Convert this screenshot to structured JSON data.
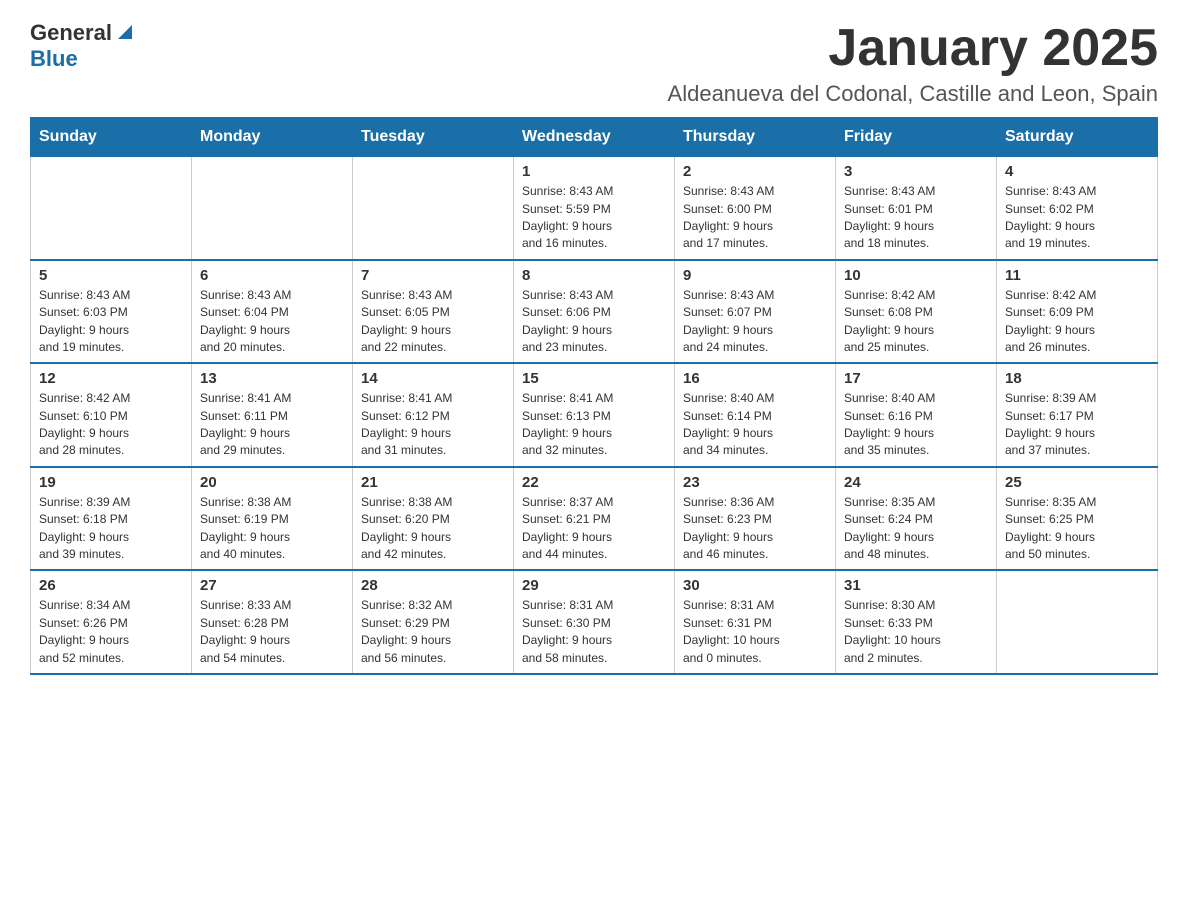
{
  "header": {
    "logo_general": "General",
    "logo_blue": "Blue",
    "title": "January 2025",
    "subtitle": "Aldeanueva del Codonal, Castille and Leon, Spain"
  },
  "days_of_week": [
    "Sunday",
    "Monday",
    "Tuesday",
    "Wednesday",
    "Thursday",
    "Friday",
    "Saturday"
  ],
  "weeks": [
    [
      {
        "day": "",
        "info": ""
      },
      {
        "day": "",
        "info": ""
      },
      {
        "day": "",
        "info": ""
      },
      {
        "day": "1",
        "info": "Sunrise: 8:43 AM\nSunset: 5:59 PM\nDaylight: 9 hours\nand 16 minutes."
      },
      {
        "day": "2",
        "info": "Sunrise: 8:43 AM\nSunset: 6:00 PM\nDaylight: 9 hours\nand 17 minutes."
      },
      {
        "day": "3",
        "info": "Sunrise: 8:43 AM\nSunset: 6:01 PM\nDaylight: 9 hours\nand 18 minutes."
      },
      {
        "day": "4",
        "info": "Sunrise: 8:43 AM\nSunset: 6:02 PM\nDaylight: 9 hours\nand 19 minutes."
      }
    ],
    [
      {
        "day": "5",
        "info": "Sunrise: 8:43 AM\nSunset: 6:03 PM\nDaylight: 9 hours\nand 19 minutes."
      },
      {
        "day": "6",
        "info": "Sunrise: 8:43 AM\nSunset: 6:04 PM\nDaylight: 9 hours\nand 20 minutes."
      },
      {
        "day": "7",
        "info": "Sunrise: 8:43 AM\nSunset: 6:05 PM\nDaylight: 9 hours\nand 22 minutes."
      },
      {
        "day": "8",
        "info": "Sunrise: 8:43 AM\nSunset: 6:06 PM\nDaylight: 9 hours\nand 23 minutes."
      },
      {
        "day": "9",
        "info": "Sunrise: 8:43 AM\nSunset: 6:07 PM\nDaylight: 9 hours\nand 24 minutes."
      },
      {
        "day": "10",
        "info": "Sunrise: 8:42 AM\nSunset: 6:08 PM\nDaylight: 9 hours\nand 25 minutes."
      },
      {
        "day": "11",
        "info": "Sunrise: 8:42 AM\nSunset: 6:09 PM\nDaylight: 9 hours\nand 26 minutes."
      }
    ],
    [
      {
        "day": "12",
        "info": "Sunrise: 8:42 AM\nSunset: 6:10 PM\nDaylight: 9 hours\nand 28 minutes."
      },
      {
        "day": "13",
        "info": "Sunrise: 8:41 AM\nSunset: 6:11 PM\nDaylight: 9 hours\nand 29 minutes."
      },
      {
        "day": "14",
        "info": "Sunrise: 8:41 AM\nSunset: 6:12 PM\nDaylight: 9 hours\nand 31 minutes."
      },
      {
        "day": "15",
        "info": "Sunrise: 8:41 AM\nSunset: 6:13 PM\nDaylight: 9 hours\nand 32 minutes."
      },
      {
        "day": "16",
        "info": "Sunrise: 8:40 AM\nSunset: 6:14 PM\nDaylight: 9 hours\nand 34 minutes."
      },
      {
        "day": "17",
        "info": "Sunrise: 8:40 AM\nSunset: 6:16 PM\nDaylight: 9 hours\nand 35 minutes."
      },
      {
        "day": "18",
        "info": "Sunrise: 8:39 AM\nSunset: 6:17 PM\nDaylight: 9 hours\nand 37 minutes."
      }
    ],
    [
      {
        "day": "19",
        "info": "Sunrise: 8:39 AM\nSunset: 6:18 PM\nDaylight: 9 hours\nand 39 minutes."
      },
      {
        "day": "20",
        "info": "Sunrise: 8:38 AM\nSunset: 6:19 PM\nDaylight: 9 hours\nand 40 minutes."
      },
      {
        "day": "21",
        "info": "Sunrise: 8:38 AM\nSunset: 6:20 PM\nDaylight: 9 hours\nand 42 minutes."
      },
      {
        "day": "22",
        "info": "Sunrise: 8:37 AM\nSunset: 6:21 PM\nDaylight: 9 hours\nand 44 minutes."
      },
      {
        "day": "23",
        "info": "Sunrise: 8:36 AM\nSunset: 6:23 PM\nDaylight: 9 hours\nand 46 minutes."
      },
      {
        "day": "24",
        "info": "Sunrise: 8:35 AM\nSunset: 6:24 PM\nDaylight: 9 hours\nand 48 minutes."
      },
      {
        "day": "25",
        "info": "Sunrise: 8:35 AM\nSunset: 6:25 PM\nDaylight: 9 hours\nand 50 minutes."
      }
    ],
    [
      {
        "day": "26",
        "info": "Sunrise: 8:34 AM\nSunset: 6:26 PM\nDaylight: 9 hours\nand 52 minutes."
      },
      {
        "day": "27",
        "info": "Sunrise: 8:33 AM\nSunset: 6:28 PM\nDaylight: 9 hours\nand 54 minutes."
      },
      {
        "day": "28",
        "info": "Sunrise: 8:32 AM\nSunset: 6:29 PM\nDaylight: 9 hours\nand 56 minutes."
      },
      {
        "day": "29",
        "info": "Sunrise: 8:31 AM\nSunset: 6:30 PM\nDaylight: 9 hours\nand 58 minutes."
      },
      {
        "day": "30",
        "info": "Sunrise: 8:31 AM\nSunset: 6:31 PM\nDaylight: 10 hours\nand 0 minutes."
      },
      {
        "day": "31",
        "info": "Sunrise: 8:30 AM\nSunset: 6:33 PM\nDaylight: 10 hours\nand 2 minutes."
      },
      {
        "day": "",
        "info": ""
      }
    ]
  ]
}
